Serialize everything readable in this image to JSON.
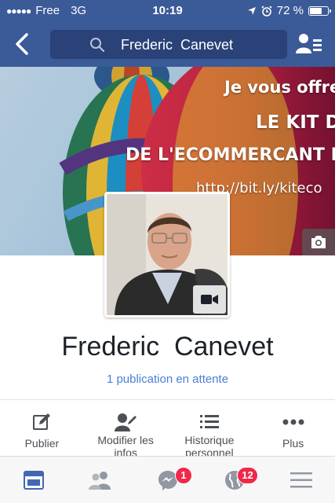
{
  "status_bar": {
    "carrier": "Free",
    "network": "3G",
    "time": "10:19",
    "battery": "72 %",
    "battery_level": 0.72
  },
  "nav": {
    "search_query": "Frederic  Canevet",
    "back_icon": "chevron-left-icon",
    "friend_requests_icon": "friend-requests-icon"
  },
  "cover": {
    "line1": "Je vous offre n",
    "line2": "LE KIT DE",
    "line3": "DE L'ECOMMERCANT DÉ",
    "line4": "http://bit.ly/kiteco",
    "camera_icon": "camera-icon"
  },
  "profile": {
    "name": "Frederic  Canevet",
    "pending": "1 publication en attente",
    "video_icon": "video-camera-icon"
  },
  "actions": [
    {
      "label": "Publier",
      "icon": "compose-icon"
    },
    {
      "label": "Modifier les infos",
      "icon": "edit-profile-icon"
    },
    {
      "label": "Historique personnel",
      "icon": "list-icon"
    },
    {
      "label": "Plus",
      "icon": "more-icon"
    }
  ],
  "tabs": [
    {
      "icon": "news-feed-icon",
      "badge": ""
    },
    {
      "icon": "friends-icon",
      "badge": ""
    },
    {
      "icon": "messenger-icon",
      "badge": "1"
    },
    {
      "icon": "globe-icon",
      "badge": "12"
    },
    {
      "icon": "menu-icon",
      "badge": ""
    }
  ],
  "colors": {
    "brand": "#3b5a98",
    "link": "#4a7ed6",
    "badge": "#f02849",
    "active_tab": "#4267b2"
  }
}
